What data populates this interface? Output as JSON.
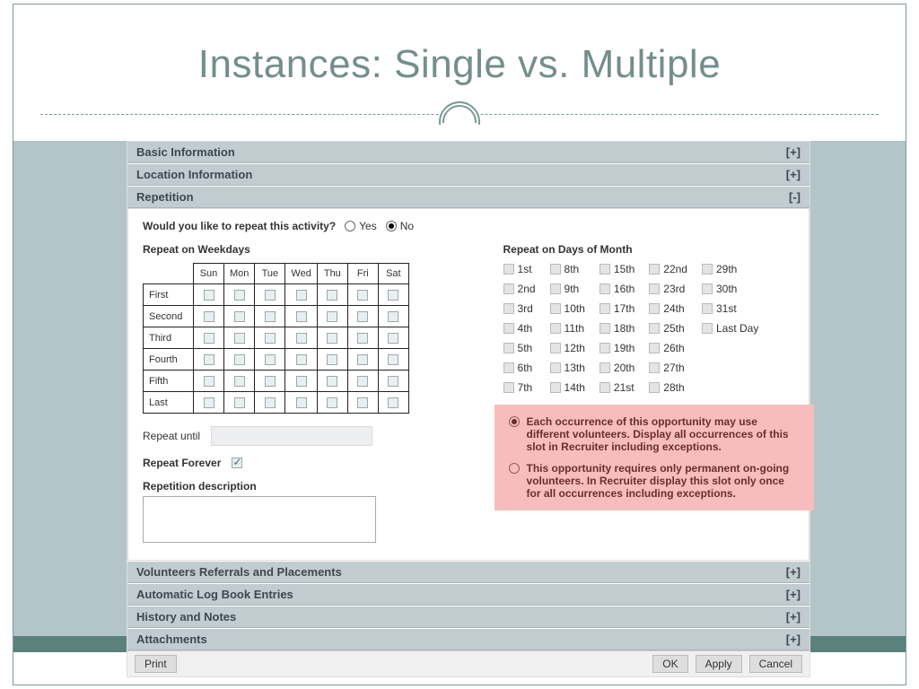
{
  "slide": {
    "title": "Instances: Single vs. Multiple"
  },
  "accordion": {
    "basic": {
      "label": "Basic Information",
      "toggle": "[+]"
    },
    "location": {
      "label": "Location Information",
      "toggle": "[+]"
    },
    "repetition": {
      "label": "Repetition",
      "toggle": "[-]"
    },
    "volunteers": {
      "label": "Volunteers Referrals and Placements",
      "toggle": "[+]"
    },
    "logbook": {
      "label": "Automatic Log Book Entries",
      "toggle": "[+]"
    },
    "history": {
      "label": "History and Notes",
      "toggle": "[+]"
    },
    "attach": {
      "label": "Attachments",
      "toggle": "[+]"
    }
  },
  "repeatQuestion": {
    "label": "Would you like to repeat this activity?",
    "yes": "Yes",
    "no": "No",
    "selected": "no"
  },
  "weekday": {
    "heading": "Repeat on Weekdays",
    "days": [
      "Sun",
      "Mon",
      "Tue",
      "Wed",
      "Thu",
      "Fri",
      "Sat"
    ],
    "rows": [
      "First",
      "Second",
      "Third",
      "Fourth",
      "Fifth",
      "Last"
    ]
  },
  "daysOfMonth": {
    "heading": "Repeat on Days of Month",
    "cols": [
      [
        "1st",
        "2nd",
        "3rd",
        "4th",
        "5th",
        "6th",
        "7th"
      ],
      [
        "8th",
        "9th",
        "10th",
        "11th",
        "12th",
        "13th",
        "14th"
      ],
      [
        "15th",
        "16th",
        "17th",
        "18th",
        "19th",
        "20th",
        "21st"
      ],
      [
        "22nd",
        "23rd",
        "24th",
        "25th",
        "26th",
        "27th",
        "28th"
      ],
      [
        "29th",
        "30th",
        "31st",
        "Last Day"
      ]
    ]
  },
  "repeatUntil": {
    "label": "Repeat until"
  },
  "repeatForever": {
    "label": "Repeat Forever",
    "checked": true
  },
  "repetitionDesc": {
    "label": "Repetition description"
  },
  "occurrenceOptions": {
    "opt1": "Each occurrence of this opportunity may use different volunteers. Display all occurrences of this slot in Recruiter including exceptions.",
    "opt2": "This opportunity requires only permanent on-going volunteers. In Recruiter display this slot only once for all occurrences including exceptions.",
    "selected": "opt1"
  },
  "footer": {
    "print": "Print",
    "ok": "OK",
    "apply": "Apply",
    "cancel": "Cancel"
  }
}
